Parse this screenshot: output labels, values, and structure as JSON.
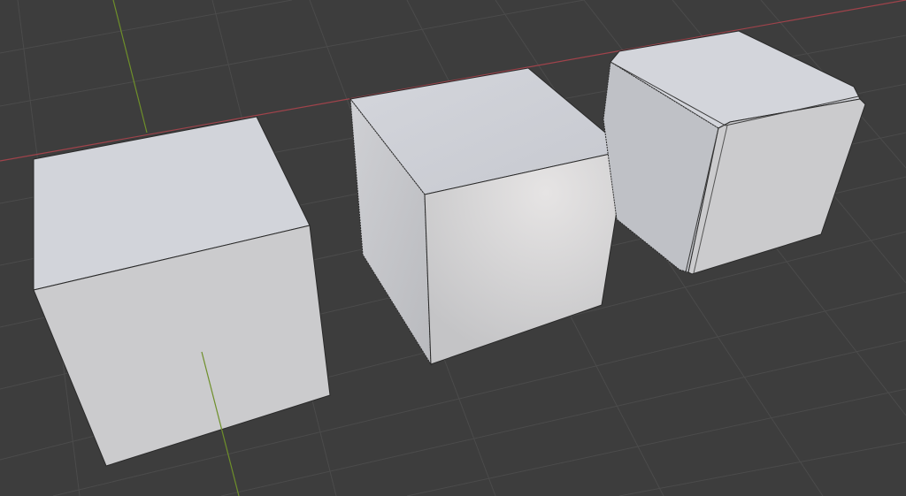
{
  "viewport": {
    "background_color": "#3d3d3d",
    "grid_color": "#4b4b4b",
    "x_axis_color": "#a0434b",
    "y_axis_color": "#6e8f2a",
    "objects": [
      {
        "name": "cube",
        "shading": "flat"
      },
      {
        "name": "cube",
        "shading": "smooth"
      },
      {
        "name": "cube",
        "shading": "bevelled"
      }
    ]
  }
}
